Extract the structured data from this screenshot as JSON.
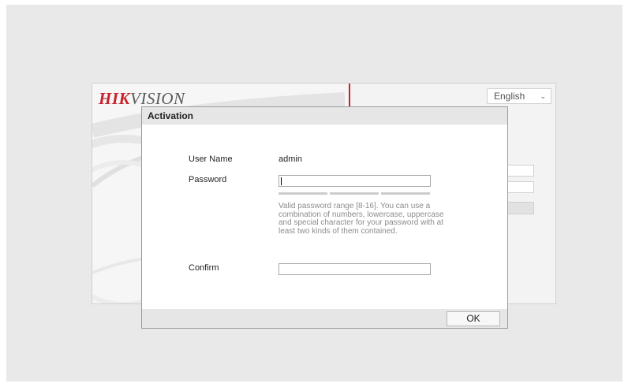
{
  "background": {
    "logo_part1": "HIK",
    "logo_part2": "VISION",
    "language": "English"
  },
  "dialog": {
    "title": "Activation",
    "username_label": "User Name",
    "username_value": "admin",
    "password_label": "Password",
    "password_value": "",
    "password_strength_segments": 3,
    "password_hint": "Valid password range [8-16]. You can use a combination of numbers, lowercase, uppercase and special character for your password with at least two kinds of them contained.",
    "confirm_label": "Confirm",
    "confirm_value": "",
    "ok_label": "OK"
  },
  "colors": {
    "brand_red": "#c8232c",
    "dialog_bar": "#e6e6e6",
    "hint_text": "#8c8c8c"
  }
}
